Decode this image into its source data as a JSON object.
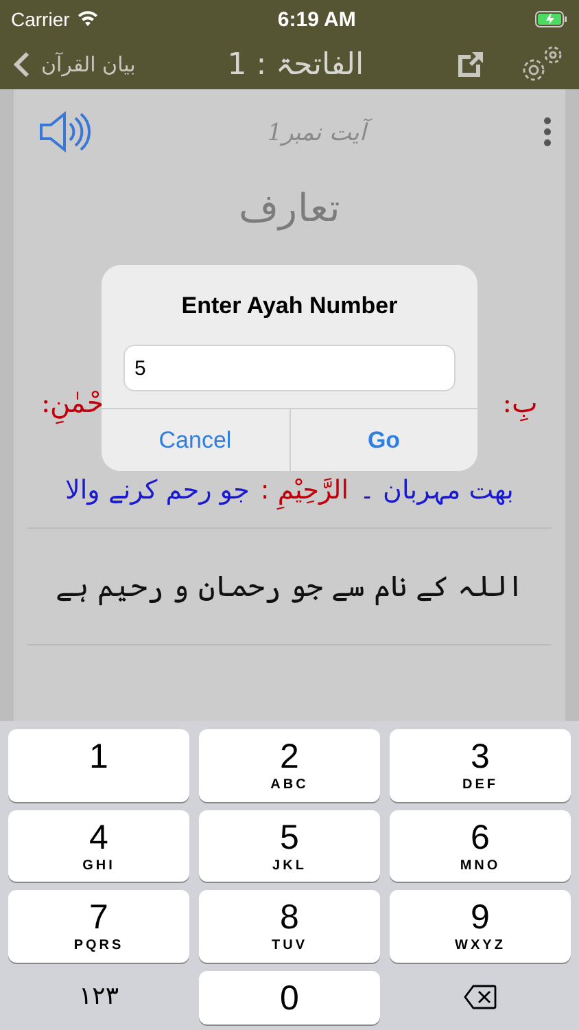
{
  "status_bar": {
    "carrier": "Carrier",
    "time": "6:19 AM"
  },
  "nav_bar": {
    "back_label": "بیان القرآن",
    "title": "الفاتحۃ : 1"
  },
  "ayah": {
    "label": "آیت نمبر1",
    "heading": "تعارف",
    "arabic_visible": [
      {
        "text": "بِ:",
        "color": "#c0000a"
      },
      {
        "text": "حْمٰنِ:",
        "color": "#c0000a"
      }
    ],
    "word_line": [
      {
        "text": "بهت مہربان ۔",
        "color": "#1a1ad0"
      },
      {
        "text": "الرَّحِیْمِ :",
        "color": "#c0000a"
      },
      {
        "text": "جو رحم کرنے والا",
        "color": "#1a1ad0"
      }
    ],
    "translation": "اللہ کے نام سے جو رحمان و رحیم ہے"
  },
  "dialog": {
    "title": "Enter Ayah Number",
    "value": "5",
    "cancel_button": "Cancel",
    "go_button": "Go"
  },
  "keyboard": {
    "rows": [
      {
        "left": {
          "kind": "digit",
          "digit": "1"
        },
        "center": {
          "kind": "digit",
          "digit": "2",
          "letters": "ABC"
        },
        "right": {
          "kind": "digit",
          "digit": "3",
          "letters": "DEF"
        }
      },
      {
        "left": {
          "kind": "digit",
          "digit": "4",
          "letters": "GHI"
        },
        "center": {
          "kind": "digit",
          "digit": "5",
          "letters": "JKL"
        },
        "right": {
          "kind": "digit",
          "digit": "6",
          "letters": "MNO"
        }
      },
      {
        "left": {
          "kind": "digit",
          "digit": "7",
          "letters": "PQRS"
        },
        "center": {
          "kind": "digit",
          "digit": "8",
          "letters": "TUV"
        },
        "right": {
          "kind": "digit",
          "digit": "9",
          "letters": "WXYZ"
        }
      },
      {
        "left": {
          "kind": "switch",
          "digit": "١٢٣"
        },
        "center": {
          "kind": "digit",
          "digit": "0"
        },
        "right": {
          "kind": "delete"
        }
      }
    ]
  }
}
